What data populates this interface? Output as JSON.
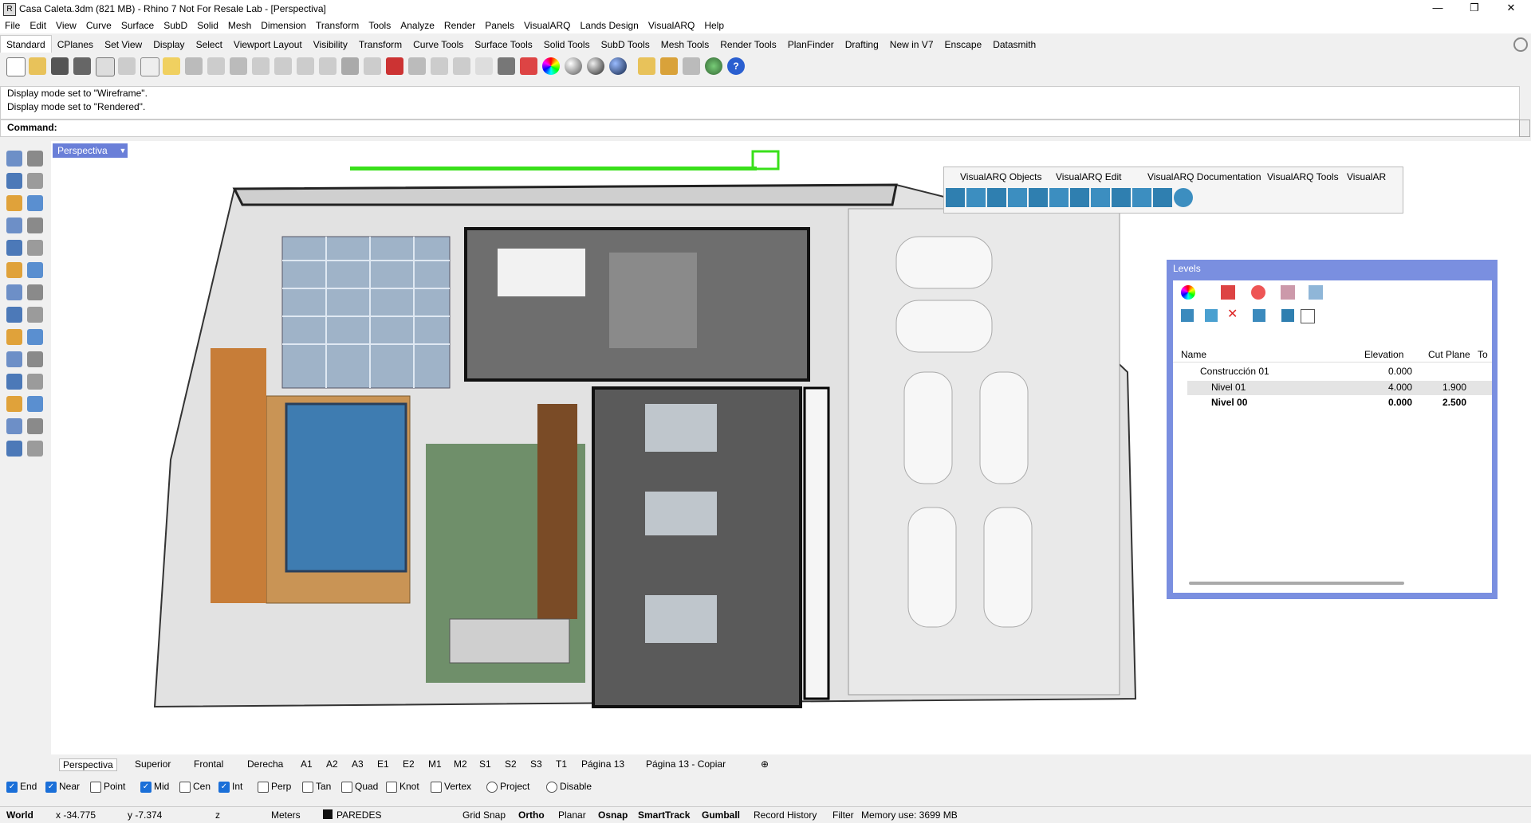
{
  "window": {
    "title": "Casa Caleta.3dm (821 MB) - Rhino 7 Not For Resale Lab - [Perspectiva]"
  },
  "menu": [
    "File",
    "Edit",
    "View",
    "Curve",
    "Surface",
    "SubD",
    "Solid",
    "Mesh",
    "Dimension",
    "Transform",
    "Tools",
    "Analyze",
    "Render",
    "Panels",
    "VisualARQ",
    "Lands Design",
    "VisualARQ",
    "Help"
  ],
  "tabs": [
    "Standard",
    "CPlanes",
    "Set View",
    "Display",
    "Select",
    "Viewport Layout",
    "Visibility",
    "Transform",
    "Curve Tools",
    "Surface Tools",
    "Solid Tools",
    "SubD Tools",
    "Mesh Tools",
    "Render Tools",
    "PlanFinder",
    "Drafting",
    "New in V7",
    "Enscape",
    "Datasmith"
  ],
  "history": [
    "Display mode set to \"Wireframe\".",
    "Display mode set to \"Rendered\"."
  ],
  "command_label": "Command:",
  "viewport": {
    "name": "Perspectiva"
  },
  "visualarq": {
    "tabs": [
      "VisualARQ Objects",
      "VisualARQ Edit",
      "VisualARQ Documentation",
      "VisualARQ Tools",
      "VisualAR"
    ]
  },
  "levels": {
    "title": "Levels",
    "columns": [
      "Name",
      "Elevation",
      "Cut Plane",
      "To"
    ],
    "rows": [
      {
        "name": "Construcción 01",
        "elevation": "0.000",
        "cut": ""
      },
      {
        "name": "Nivel 01",
        "elevation": "4.000",
        "cut": "1.900"
      },
      {
        "name": "Nivel 00",
        "elevation": "0.000",
        "cut": "2.500"
      }
    ]
  },
  "view_tabs": [
    "Perspectiva",
    "Superior",
    "Frontal",
    "Derecha",
    "A1",
    "A2",
    "A3",
    "E1",
    "E2",
    "M1",
    "M2",
    "S1",
    "S2",
    "S3",
    "T1",
    "Página 13",
    "Página 13 - Copiar"
  ],
  "osnaps": [
    {
      "label": "End",
      "checked": true
    },
    {
      "label": "Near",
      "checked": true
    },
    {
      "label": "Point",
      "checked": false
    },
    {
      "label": "Mid",
      "checked": true
    },
    {
      "label": "Cen",
      "checked": false
    },
    {
      "label": "Int",
      "checked": true
    },
    {
      "label": "Perp",
      "checked": false
    },
    {
      "label": "Tan",
      "checked": false
    },
    {
      "label": "Quad",
      "checked": false
    },
    {
      "label": "Knot",
      "checked": false
    },
    {
      "label": "Vertex",
      "checked": false
    }
  ],
  "osnap_extra": {
    "project": "Project",
    "disable": "Disable"
  },
  "status": {
    "cplane": "World",
    "x": "x -34.775",
    "y": "y -7.374",
    "z": "z",
    "units": "Meters",
    "layer": "PAREDES",
    "grid": "Grid Snap",
    "ortho": "Ortho",
    "planar": "Planar",
    "osnap": "Osnap",
    "smarttrack": "SmartTrack",
    "gumball": "Gumball",
    "history": "Record History",
    "filter": "Filter",
    "memory": "Memory use: 3699 MB"
  }
}
